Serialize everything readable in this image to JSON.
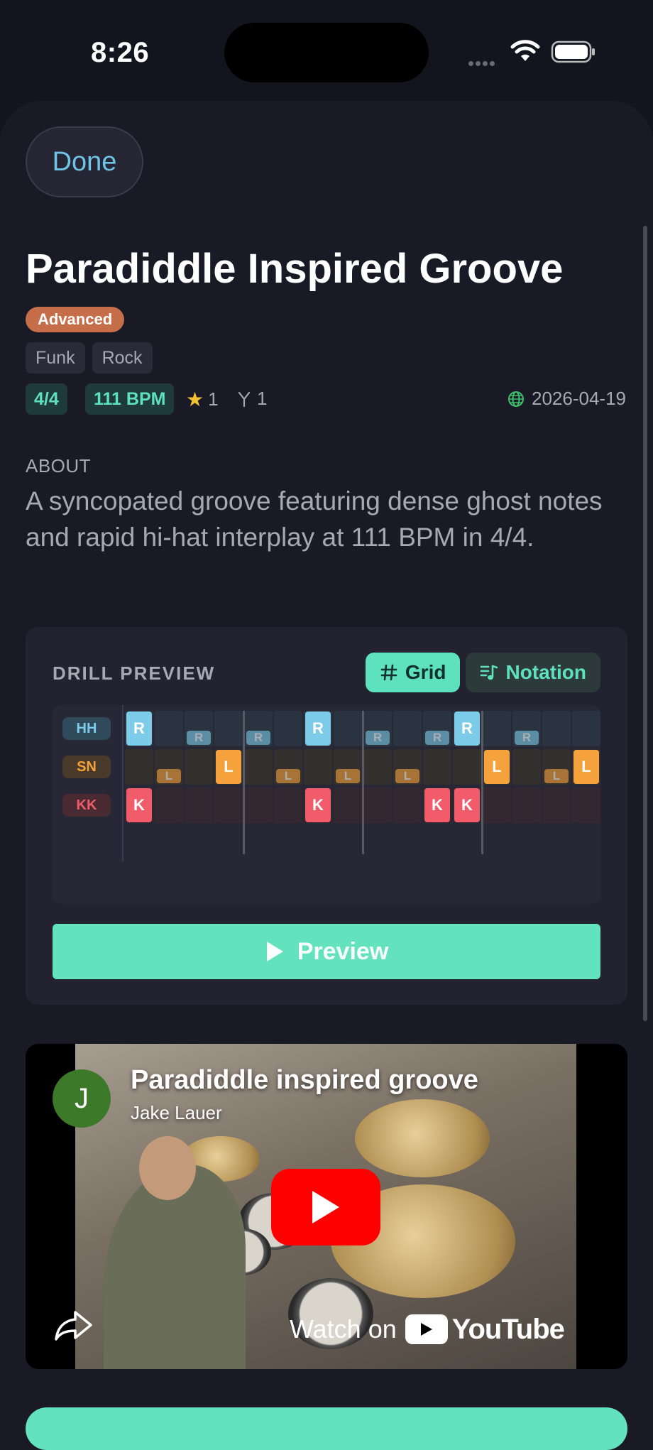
{
  "status_bar": {
    "time": "8:26"
  },
  "header": {
    "done_label": "Done"
  },
  "groove": {
    "title": "Paradiddle Inspired Groove",
    "level": "Advanced",
    "tags": [
      "Funk",
      "Rock"
    ],
    "time_signature": "4/4",
    "tempo": "111 BPM",
    "stars": "1",
    "forks": "1",
    "date": "2026-04-19"
  },
  "about": {
    "label": "ABOUT",
    "text": "A syncopated groove featuring dense ghost notes and rapid hi-hat interplay at 111 BPM in 4/4."
  },
  "drill_preview": {
    "label": "DRILL PREVIEW",
    "grid_label": "Grid",
    "notation_label": "Notation",
    "preview_label": "Preview",
    "lanes": [
      {
        "label": "HH",
        "color": "#7ccbe8",
        "label_bg": "#2f4a5a",
        "label_color": "#7ccbe8",
        "cell_bg": "#2a3340",
        "notes": [
          {
            "step": 0,
            "text": "R",
            "accent": true
          },
          {
            "step": 2,
            "text": "R",
            "accent": false
          },
          {
            "step": 4,
            "text": "R",
            "accent": false
          },
          {
            "step": 6,
            "text": "R",
            "accent": true
          },
          {
            "step": 8,
            "text": "R",
            "accent": false
          },
          {
            "step": 10,
            "text": "R",
            "accent": false
          },
          {
            "step": 11,
            "text": "R",
            "accent": true
          },
          {
            "step": 13,
            "text": "R",
            "accent": false
          }
        ]
      },
      {
        "label": "SN",
        "color": "#f5a13c",
        "label_bg": "#4a3a2c",
        "label_color": "#f5a13c",
        "cell_bg": "#33302e",
        "notes": [
          {
            "step": 1,
            "text": "L",
            "accent": false
          },
          {
            "step": 3,
            "text": "L",
            "accent": true
          },
          {
            "step": 5,
            "text": "L",
            "accent": false
          },
          {
            "step": 7,
            "text": "L",
            "accent": false
          },
          {
            "step": 9,
            "text": "L",
            "accent": false
          },
          {
            "step": 12,
            "text": "L",
            "accent": true
          },
          {
            "step": 14,
            "text": "L",
            "accent": false
          },
          {
            "step": 15,
            "text": "L",
            "accent": true
          }
        ]
      },
      {
        "label": "KK",
        "color": "#f25c6a",
        "label_bg": "#4a2a32",
        "label_color": "#f25c6a",
        "cell_bg": "#33282f",
        "notes": [
          {
            "step": 0,
            "text": "K",
            "accent": true
          },
          {
            "step": 6,
            "text": "K",
            "accent": true
          },
          {
            "step": 10,
            "text": "K",
            "accent": true
          },
          {
            "step": 11,
            "text": "K",
            "accent": true
          }
        ]
      }
    ],
    "steps": 16
  },
  "video": {
    "avatar_letter": "J",
    "title": "Paradiddle inspired groove",
    "channel": "Jake Lauer",
    "watch_on": "Watch on",
    "brand": "YouTube"
  }
}
